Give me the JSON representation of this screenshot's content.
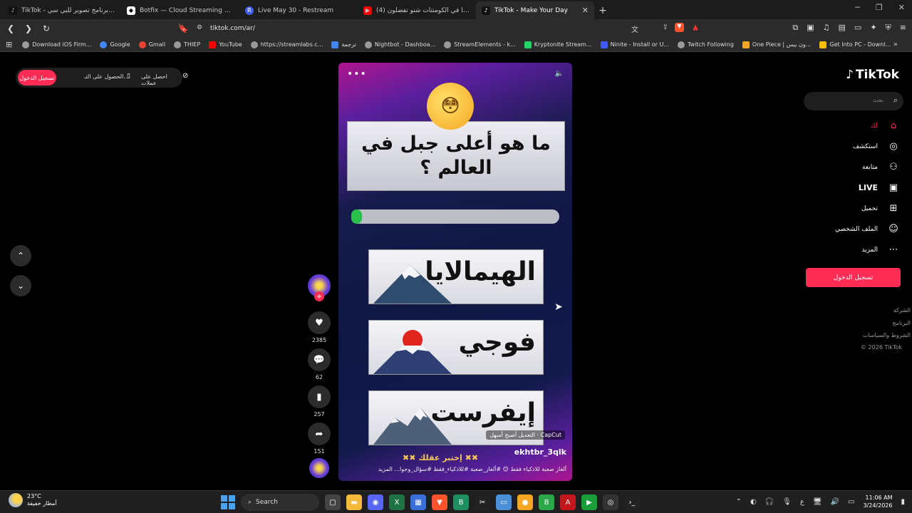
{
  "tabs": [
    {
      "label": "TikTok - أفضل برنامج تصوير للبي سي:",
      "icon": "tiktok-icon",
      "color": "#111111"
    },
    {
      "label": "Botfix — Cloud Streaming Bot for Tw",
      "icon": "botfix-icon",
      "color": "#ffffff"
    },
    {
      "label": "Live May 30 - Restream",
      "icon": "restream-icon",
      "color": "#3f5ef0"
    },
    {
      "label": "(4) خبرونا في الكومنتات شنو تفضلون",
      "icon": "youtube-icon",
      "color": "#ff0000"
    },
    {
      "label": "TikTok - Make Your Day",
      "icon": "tiktok-icon",
      "color": "#111111"
    }
  ],
  "address": {
    "url": "tiktok.com/ar/"
  },
  "bookmarks": [
    {
      "label": "Download iOS Firm...",
      "color": "#9a9a9a"
    },
    {
      "label": "Google",
      "color": "#4285f4"
    },
    {
      "label": "Gmail",
      "color": "#ea4335"
    },
    {
      "label": "THIEP",
      "color": "#9a9a9a"
    },
    {
      "label": "YouTube",
      "color": "#ff0000"
    },
    {
      "label": "https://streamlabs.c...",
      "color": "#9a9a9a"
    },
    {
      "label": "ترجمة",
      "color": "#4285f4"
    },
    {
      "label": "Nightbot - Dashboa...",
      "color": "#9a9a9a"
    },
    {
      "label": "StreamElements - k...",
      "color": "#9a9a9a"
    },
    {
      "label": "Kryptonite Stream...",
      "color": "#25d366"
    },
    {
      "label": "Ninite - Install or U...",
      "color": "#3d5afe"
    },
    {
      "label": "Twitch Following",
      "color": "#9a9a9a"
    },
    {
      "label": "One Piece | ون بيس...",
      "color": "#f5a623"
    },
    {
      "label": "Get Into PC - Downl...",
      "color": "#fbbc05"
    }
  ],
  "topleft": {
    "login": "تسجيل الدخول",
    "getapp": "الحصول على التـ...",
    "getcoins": "احصل على عملات"
  },
  "video": {
    "question": "ما هو أعلى جبل في العالم ؟",
    "progress": 0.05,
    "answers": [
      "الهيمالايا",
      "فوجي",
      "إيفرست"
    ],
    "capcut": "CapCut · التعديل أصبح أسهل",
    "author": "ekhtbr_3qlk",
    "caption": "ألغاز صعبة للاذكياء فقط 😊 #ألغاز_صعبة #للاذكياء_فقط #سؤال_وجوا...  المزيد",
    "challenge": "✖✖ إختبر عقلك ✖✖"
  },
  "actions": {
    "likes": "2385",
    "comments": "62",
    "saves": "257",
    "shares": "151"
  },
  "sidebar": {
    "logo": "TikTok",
    "search_placeholder": "بحث",
    "items": [
      {
        "label": "لك",
        "icon": "home-icon"
      },
      {
        "label": "استكشف",
        "icon": "compass-icon"
      },
      {
        "label": "متابعة",
        "icon": "follow-icon"
      },
      {
        "label": "LIVE",
        "icon": "live-icon"
      },
      {
        "label": "تحميل",
        "icon": "upload-icon"
      },
      {
        "label": "الملف الشخصي",
        "icon": "profile-icon"
      },
      {
        "label": "المزيد",
        "icon": "more-icon"
      }
    ],
    "login": "تسجيل الدخول",
    "footer": [
      "الشركة",
      "البرنامج",
      "الشروط والسياسات",
      "© 2026 TikTok"
    ]
  },
  "taskbar": {
    "temp": "23°C",
    "weather": "أمطار خفيفة",
    "search": "Search",
    "time": "11:06 AM",
    "date": "3/24/2026",
    "lang": "ع"
  },
  "colors": {
    "brand": "#fe2c55",
    "progress": "#28c04a"
  }
}
